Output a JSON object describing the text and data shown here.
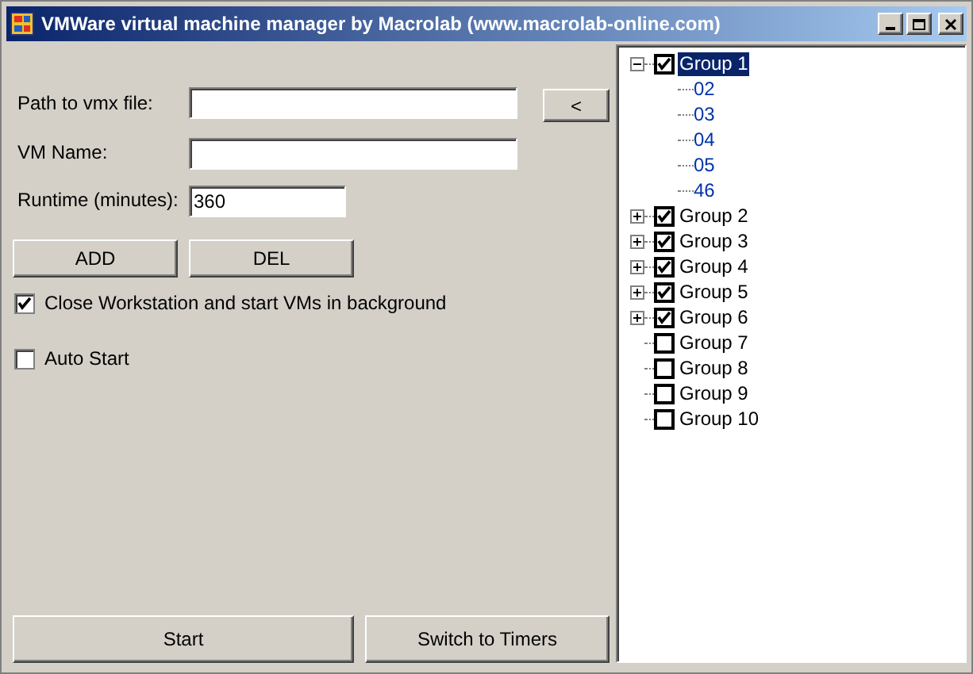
{
  "window": {
    "title": "VMWare virtual machine manager by Macrolab (www.macrolab-online.com)"
  },
  "form": {
    "path_label": "Path to vmx file:",
    "browse_button": "<",
    "name_label": "VM Name:",
    "runtime_label": "Runtime (minutes):",
    "runtime_value": "360",
    "add_button": "ADD",
    "del_button": "DEL",
    "options": [
      {
        "label": "Close Workstation and start VMs in background",
        "checked": true
      },
      {
        "label": "Auto Start",
        "checked": false
      }
    ],
    "start_button": "Start",
    "timers_button": "Switch to Timers"
  },
  "tree": [
    {
      "label": "Group 1",
      "checked": true,
      "selected": true,
      "expanded": true,
      "children": [
        {
          "label": "02"
        },
        {
          "label": "03"
        },
        {
          "label": "04"
        },
        {
          "label": "05"
        },
        {
          "label": "46"
        }
      ]
    },
    {
      "label": "Group 2",
      "checked": true,
      "selected": false,
      "expanded": false
    },
    {
      "label": "Group 3",
      "checked": true,
      "selected": false,
      "expanded": false
    },
    {
      "label": "Group 4",
      "checked": true,
      "selected": false,
      "expanded": false
    },
    {
      "label": "Group 5",
      "checked": true,
      "selected": false,
      "expanded": false
    },
    {
      "label": "Group 6",
      "checked": true,
      "selected": false,
      "expanded": false
    },
    {
      "label": "Group 7",
      "checked": false,
      "selected": false
    },
    {
      "label": "Group 8",
      "checked": false,
      "selected": false
    },
    {
      "label": "Group 9",
      "checked": false,
      "selected": false
    },
    {
      "label": "Group 10",
      "checked": false,
      "selected": false
    }
  ]
}
